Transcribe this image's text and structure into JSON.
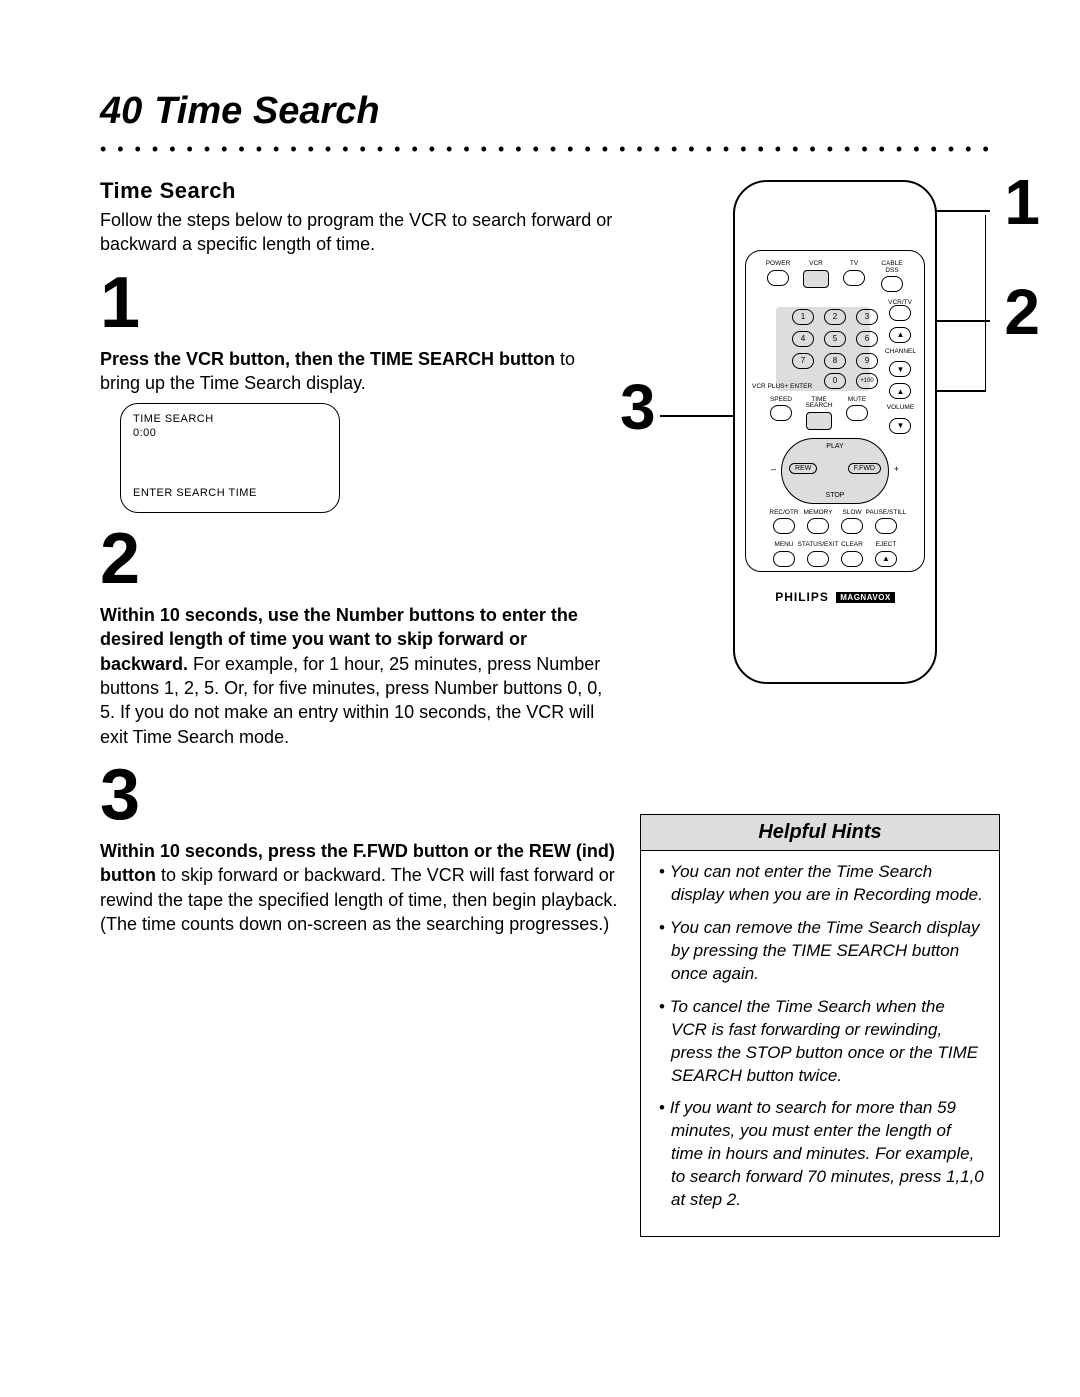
{
  "page": {
    "number": "40",
    "title": "Time Search"
  },
  "section": {
    "heading": "Time Search",
    "intro": "Follow the steps below to program the VCR to search forward or backward a specific length of time."
  },
  "steps": {
    "s1": {
      "num": "1",
      "bold": "Press the VCR button, then the TIME SEARCH button",
      "rest": " to bring up the Time Search display."
    },
    "s2": {
      "num": "2",
      "bold": "Within 10 seconds, use the Number buttons to enter the desired length of time you want to skip forward or backward.",
      "rest": " For example, for 1 hour, 25 minutes, press Number buttons 1, 2, 5. Or, for five minutes, press Number buttons 0, 0, 5. If you do not make an entry within 10 seconds, the VCR will exit Time Search mode."
    },
    "s3": {
      "num": "3",
      "bold": "Within 10 seconds, press the F.FWD button or the REW (ind) button",
      "rest": " to skip forward or backward. The VCR will fast forward or rewind the tape the specified length of time, then begin playback. (The time counts down on-screen as the searching progresses.)"
    }
  },
  "display": {
    "l1": "TIME SEARCH",
    "l2": "0:00",
    "l3": "ENTER SEARCH TIME"
  },
  "callouts": {
    "c1": "1",
    "c2": "2",
    "c3": "3"
  },
  "remote": {
    "top_labels": {
      "power": "POWER",
      "vcr": "VCR",
      "tv": "TV",
      "cable": "CABLE DSS"
    },
    "vcrtv_label": "VCR/TV",
    "keypad": {
      "k1": "1",
      "k2": "2",
      "k3": "3",
      "k4": "4",
      "k5": "5",
      "k6": "6",
      "k7": "7",
      "k8": "8",
      "k9": "9",
      "k0": "0",
      "k100": "+100"
    },
    "vcrplus_label": "VCR PLUS+ ENTER",
    "channel_label": "CHANNEL",
    "row4": {
      "speed": "SPEED",
      "timesearch": "TIME SEARCH",
      "mute": "MUTE",
      "volume": "VOLUME"
    },
    "nav": {
      "play": "PLAY",
      "stop": "STOP",
      "rew": "REW",
      "ffwd": "F.FWD",
      "minus": "–",
      "plus": "+"
    },
    "row5": {
      "recotr": "REC/OTR",
      "memory": "MEMORY",
      "slow": "SLOW",
      "pause": "PAUSE/STILL"
    },
    "row6": {
      "menu": "MENU",
      "status": "STATUS/EXIT",
      "clear": "CLEAR",
      "eject": "EJECT"
    },
    "brand": "PHILIPS",
    "brand_sub": "MAGNAVOX"
  },
  "hints": {
    "title": "Helpful Hints",
    "items": [
      "You can not enter the Time Search display when you are in Recording mode.",
      "You can remove the Time Search display by pressing the TIME SEARCH button once again.",
      "To cancel the Time Search when the VCR is fast forwarding or rewinding, press the STOP button once or the TIME SEARCH button twice.",
      "If you want to search for more than 59 minutes, you must enter the length of time in hours and minutes. For example, to search forward 70 minutes, press 1,1,0 at step 2."
    ]
  }
}
